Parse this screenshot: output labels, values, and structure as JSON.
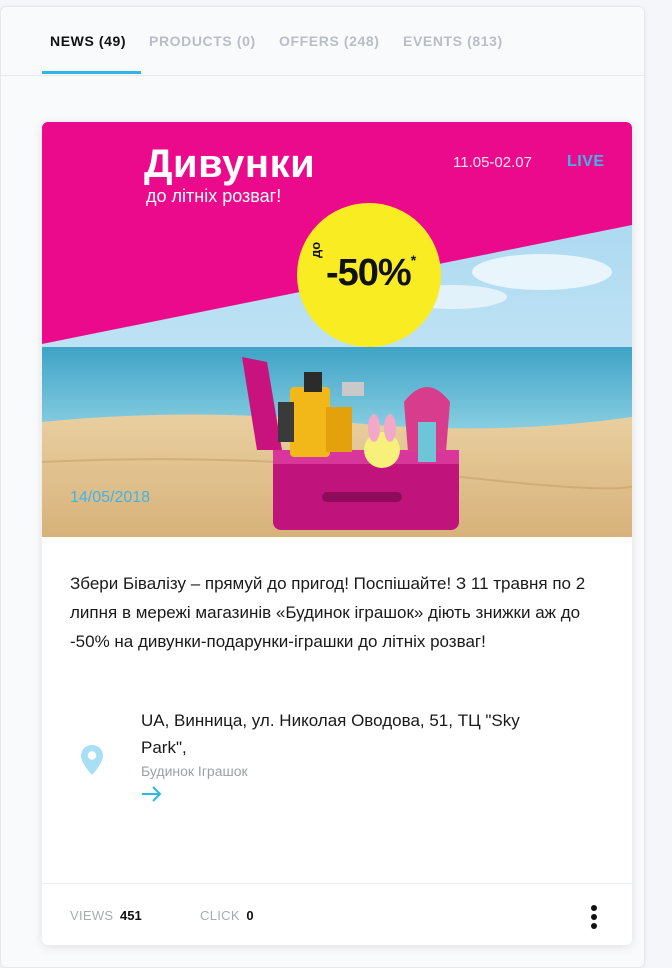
{
  "tabs": [
    {
      "label": "NEWS (49)",
      "active": true
    },
    {
      "label": "PRODUCTS (0)",
      "active": false
    },
    {
      "label": "OFFERS (248)",
      "active": false
    },
    {
      "label": "EVENTS (813)",
      "active": false
    }
  ],
  "colors": {
    "accent": "#2fb6e6",
    "banner_pink": "#ec0a8c",
    "badge_yellow": "#f9ec23"
  },
  "card": {
    "banner": {
      "title": "Дивунки",
      "subtitle": "до літніх розваг!",
      "dates": "11.05-02.07",
      "live": "LIVE",
      "discount_prefix": "до",
      "discount": "-50%",
      "discount_mark": "*",
      "date": "14/05/2018"
    },
    "description": "Збери Бівалізу – прямуй до пригод! Поспішайте! З 11 травня по 2 липня в мережі магазинів «Будинок іграшок» діють знижки аж до -50% на дивунки-подарунки-іграшки до літніх розваг!",
    "location": {
      "address": "UA, Винница, ул. Николая Оводова, 51, ТЦ \"Sky Park\",",
      "store": "Будинок Іграшок",
      "icon": "map-pin-icon",
      "link_icon": "arrow-right-icon"
    },
    "stats": {
      "views_label": "VIEWS",
      "views_value": "451",
      "click_label": "CLICK",
      "click_value": "0"
    },
    "menu_icon": "more-vertical-icon"
  }
}
